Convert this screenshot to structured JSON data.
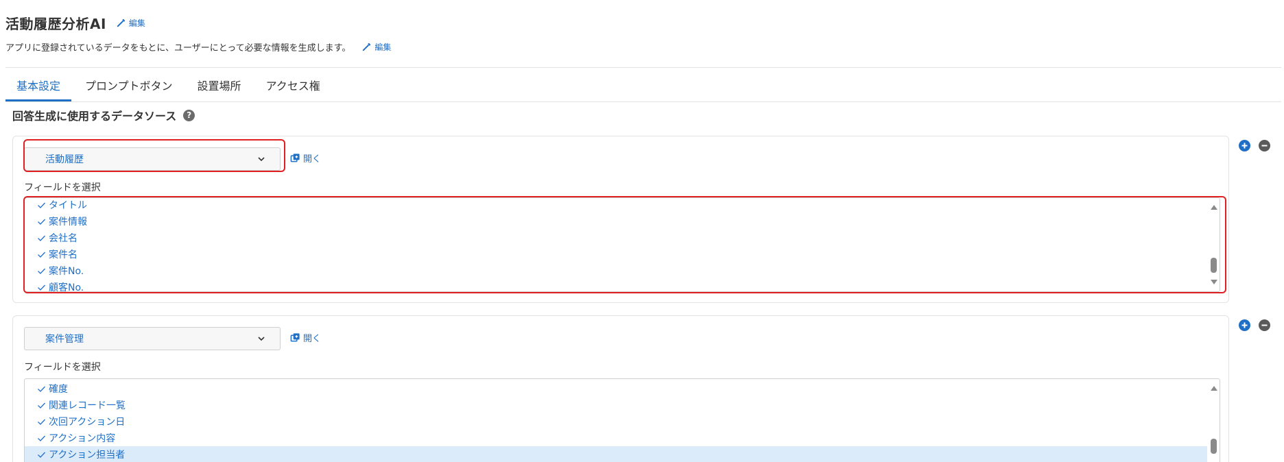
{
  "app": {
    "title": "活動履歴分析AI",
    "description": "アプリに登録されているデータをもとに、ユーザーにとって必要な情報を生成します。",
    "edit_label": "編集"
  },
  "tabs": [
    {
      "label": "基本設定",
      "active": true
    },
    {
      "label": "プロンプトボタン",
      "active": false
    },
    {
      "label": "設置場所",
      "active": false
    },
    {
      "label": "アクセス権",
      "active": false
    }
  ],
  "section": {
    "title": "回答生成に使用するデータソース",
    "help_icon": "?"
  },
  "open_label": "開く",
  "field_select_label": "フィールドを選択",
  "datasources": [
    {
      "source": "活動履歴",
      "fields": [
        "タイトル",
        "案件情報",
        "会社名",
        "案件名",
        "案件No.",
        "顧客No."
      ]
    },
    {
      "source": "案件管理",
      "fields": [
        "確度",
        "関連レコード一覧",
        "次回アクション日",
        "アクション内容",
        "アクション担当者"
      ],
      "selected_field": "アクション担当者"
    }
  ],
  "colors": {
    "accent": "#1f6fc5",
    "highlight": "#e02020",
    "selected_row": "#dcebf9"
  },
  "icons": {
    "edit": "pencil-icon",
    "open": "open-window-icon",
    "check": "check-icon",
    "chevron": "chevron-down-icon",
    "add": "plus-circle-icon",
    "remove": "minus-circle-icon"
  }
}
